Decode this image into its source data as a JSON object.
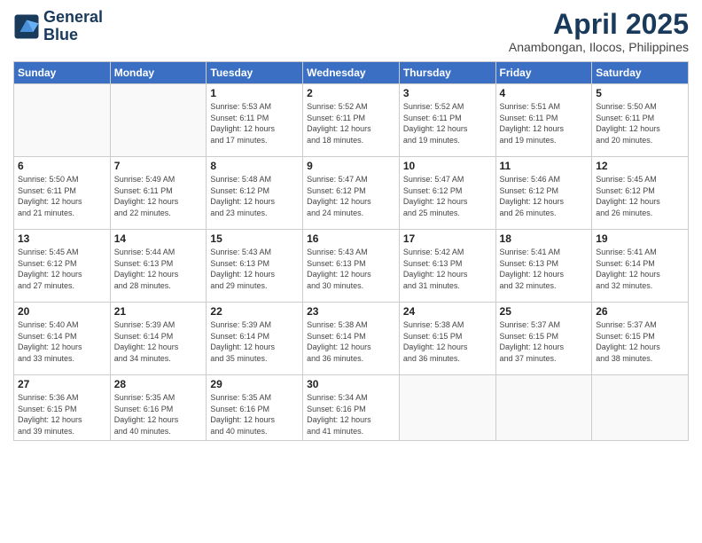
{
  "logo": {
    "line1": "General",
    "line2": "Blue"
  },
  "title": "April 2025",
  "location": "Anambongan, Ilocos, Philippines",
  "weekdays": [
    "Sunday",
    "Monday",
    "Tuesday",
    "Wednesday",
    "Thursday",
    "Friday",
    "Saturday"
  ],
  "weeks": [
    [
      {
        "day": "",
        "info": ""
      },
      {
        "day": "",
        "info": ""
      },
      {
        "day": "1",
        "info": "Sunrise: 5:53 AM\nSunset: 6:11 PM\nDaylight: 12 hours\nand 17 minutes."
      },
      {
        "day": "2",
        "info": "Sunrise: 5:52 AM\nSunset: 6:11 PM\nDaylight: 12 hours\nand 18 minutes."
      },
      {
        "day": "3",
        "info": "Sunrise: 5:52 AM\nSunset: 6:11 PM\nDaylight: 12 hours\nand 19 minutes."
      },
      {
        "day": "4",
        "info": "Sunrise: 5:51 AM\nSunset: 6:11 PM\nDaylight: 12 hours\nand 19 minutes."
      },
      {
        "day": "5",
        "info": "Sunrise: 5:50 AM\nSunset: 6:11 PM\nDaylight: 12 hours\nand 20 minutes."
      }
    ],
    [
      {
        "day": "6",
        "info": "Sunrise: 5:50 AM\nSunset: 6:11 PM\nDaylight: 12 hours\nand 21 minutes."
      },
      {
        "day": "7",
        "info": "Sunrise: 5:49 AM\nSunset: 6:11 PM\nDaylight: 12 hours\nand 22 minutes."
      },
      {
        "day": "8",
        "info": "Sunrise: 5:48 AM\nSunset: 6:12 PM\nDaylight: 12 hours\nand 23 minutes."
      },
      {
        "day": "9",
        "info": "Sunrise: 5:47 AM\nSunset: 6:12 PM\nDaylight: 12 hours\nand 24 minutes."
      },
      {
        "day": "10",
        "info": "Sunrise: 5:47 AM\nSunset: 6:12 PM\nDaylight: 12 hours\nand 25 minutes."
      },
      {
        "day": "11",
        "info": "Sunrise: 5:46 AM\nSunset: 6:12 PM\nDaylight: 12 hours\nand 26 minutes."
      },
      {
        "day": "12",
        "info": "Sunrise: 5:45 AM\nSunset: 6:12 PM\nDaylight: 12 hours\nand 26 minutes."
      }
    ],
    [
      {
        "day": "13",
        "info": "Sunrise: 5:45 AM\nSunset: 6:12 PM\nDaylight: 12 hours\nand 27 minutes."
      },
      {
        "day": "14",
        "info": "Sunrise: 5:44 AM\nSunset: 6:13 PM\nDaylight: 12 hours\nand 28 minutes."
      },
      {
        "day": "15",
        "info": "Sunrise: 5:43 AM\nSunset: 6:13 PM\nDaylight: 12 hours\nand 29 minutes."
      },
      {
        "day": "16",
        "info": "Sunrise: 5:43 AM\nSunset: 6:13 PM\nDaylight: 12 hours\nand 30 minutes."
      },
      {
        "day": "17",
        "info": "Sunrise: 5:42 AM\nSunset: 6:13 PM\nDaylight: 12 hours\nand 31 minutes."
      },
      {
        "day": "18",
        "info": "Sunrise: 5:41 AM\nSunset: 6:13 PM\nDaylight: 12 hours\nand 32 minutes."
      },
      {
        "day": "19",
        "info": "Sunrise: 5:41 AM\nSunset: 6:14 PM\nDaylight: 12 hours\nand 32 minutes."
      }
    ],
    [
      {
        "day": "20",
        "info": "Sunrise: 5:40 AM\nSunset: 6:14 PM\nDaylight: 12 hours\nand 33 minutes."
      },
      {
        "day": "21",
        "info": "Sunrise: 5:39 AM\nSunset: 6:14 PM\nDaylight: 12 hours\nand 34 minutes."
      },
      {
        "day": "22",
        "info": "Sunrise: 5:39 AM\nSunset: 6:14 PM\nDaylight: 12 hours\nand 35 minutes."
      },
      {
        "day": "23",
        "info": "Sunrise: 5:38 AM\nSunset: 6:14 PM\nDaylight: 12 hours\nand 36 minutes."
      },
      {
        "day": "24",
        "info": "Sunrise: 5:38 AM\nSunset: 6:15 PM\nDaylight: 12 hours\nand 36 minutes."
      },
      {
        "day": "25",
        "info": "Sunrise: 5:37 AM\nSunset: 6:15 PM\nDaylight: 12 hours\nand 37 minutes."
      },
      {
        "day": "26",
        "info": "Sunrise: 5:37 AM\nSunset: 6:15 PM\nDaylight: 12 hours\nand 38 minutes."
      }
    ],
    [
      {
        "day": "27",
        "info": "Sunrise: 5:36 AM\nSunset: 6:15 PM\nDaylight: 12 hours\nand 39 minutes."
      },
      {
        "day": "28",
        "info": "Sunrise: 5:35 AM\nSunset: 6:16 PM\nDaylight: 12 hours\nand 40 minutes."
      },
      {
        "day": "29",
        "info": "Sunrise: 5:35 AM\nSunset: 6:16 PM\nDaylight: 12 hours\nand 40 minutes."
      },
      {
        "day": "30",
        "info": "Sunrise: 5:34 AM\nSunset: 6:16 PM\nDaylight: 12 hours\nand 41 minutes."
      },
      {
        "day": "",
        "info": ""
      },
      {
        "day": "",
        "info": ""
      },
      {
        "day": "",
        "info": ""
      }
    ]
  ]
}
